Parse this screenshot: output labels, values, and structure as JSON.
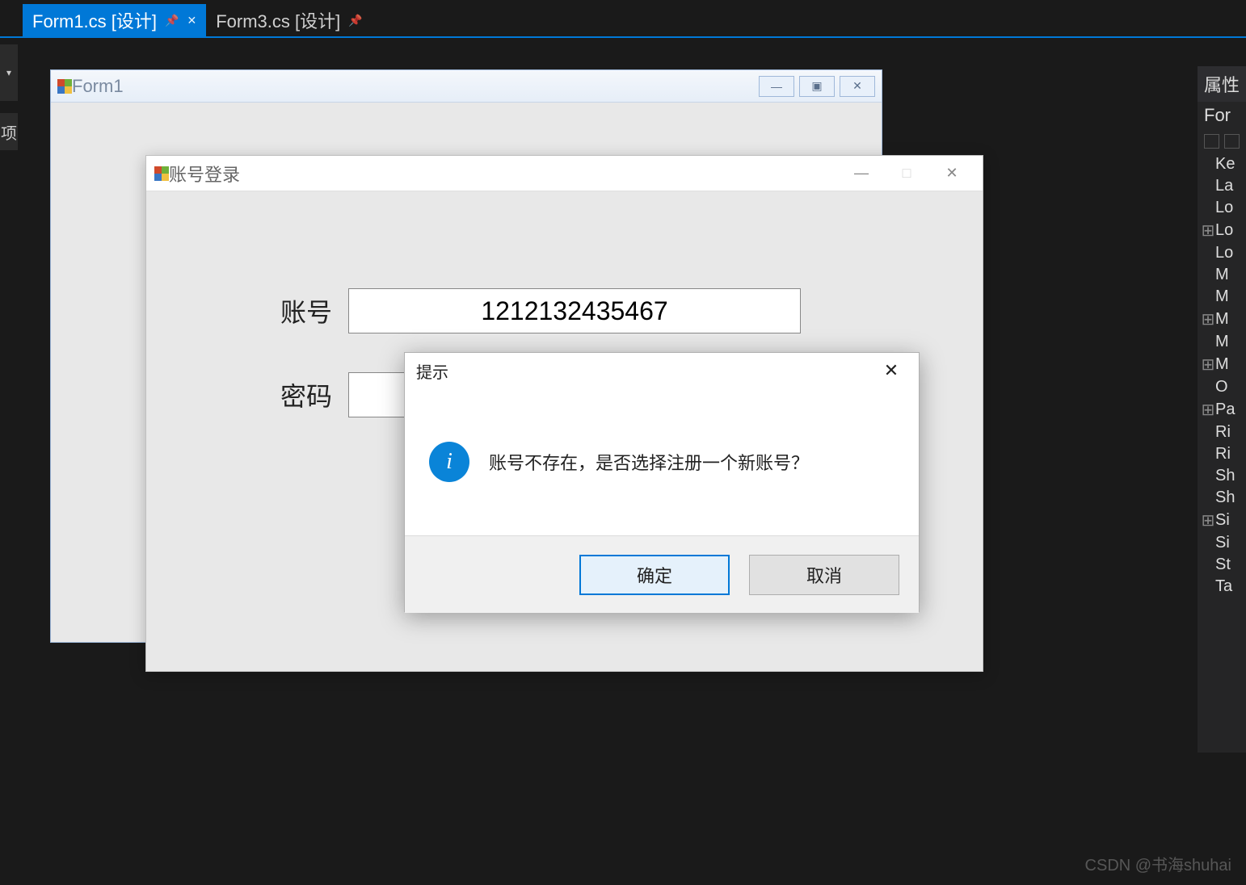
{
  "tabs": [
    {
      "label": "Form1.cs [设计]",
      "active": true
    },
    {
      "label": "Form3.cs [设计]",
      "active": false
    }
  ],
  "left_gutter2": "项",
  "form1": {
    "title": "Form1",
    "buttons": {
      "min": "—",
      "max": "▣",
      "close": "✕"
    }
  },
  "login": {
    "title": "账号登录",
    "account_label": "账号",
    "account_value": "1212132435467",
    "password_label": "密码",
    "password_value": "",
    "ctrl": {
      "min": "—",
      "max": "□",
      "close": "✕"
    }
  },
  "msgbox": {
    "title": "提示",
    "text": "账号不存在，是否选择注册一个新账号？",
    "ok": "确定",
    "cancel": "取消",
    "close": "✕"
  },
  "props": {
    "header": "属性",
    "sub": "For",
    "rows": [
      {
        "exp": "",
        "name": "Ke"
      },
      {
        "exp": "",
        "name": "La"
      },
      {
        "exp": "",
        "name": "Lo"
      },
      {
        "exp": "⊞",
        "name": "Lo"
      },
      {
        "exp": "",
        "name": "Lo"
      },
      {
        "exp": "",
        "name": "M"
      },
      {
        "exp": "",
        "name": "M"
      },
      {
        "exp": "⊞",
        "name": "M"
      },
      {
        "exp": "",
        "name": "M"
      },
      {
        "exp": "⊞",
        "name": "M"
      },
      {
        "exp": "",
        "name": "O"
      },
      {
        "exp": "⊞",
        "name": "Pa"
      },
      {
        "exp": "",
        "name": "Ri"
      },
      {
        "exp": "",
        "name": "Ri"
      },
      {
        "exp": "",
        "name": "Sh"
      },
      {
        "exp": "",
        "name": "Sh"
      },
      {
        "exp": "⊞",
        "name": "Si"
      },
      {
        "exp": "",
        "name": "Si"
      },
      {
        "exp": "",
        "name": "St"
      },
      {
        "exp": "",
        "name": "Ta"
      }
    ]
  },
  "watermark": "CSDN @书海shuhai"
}
